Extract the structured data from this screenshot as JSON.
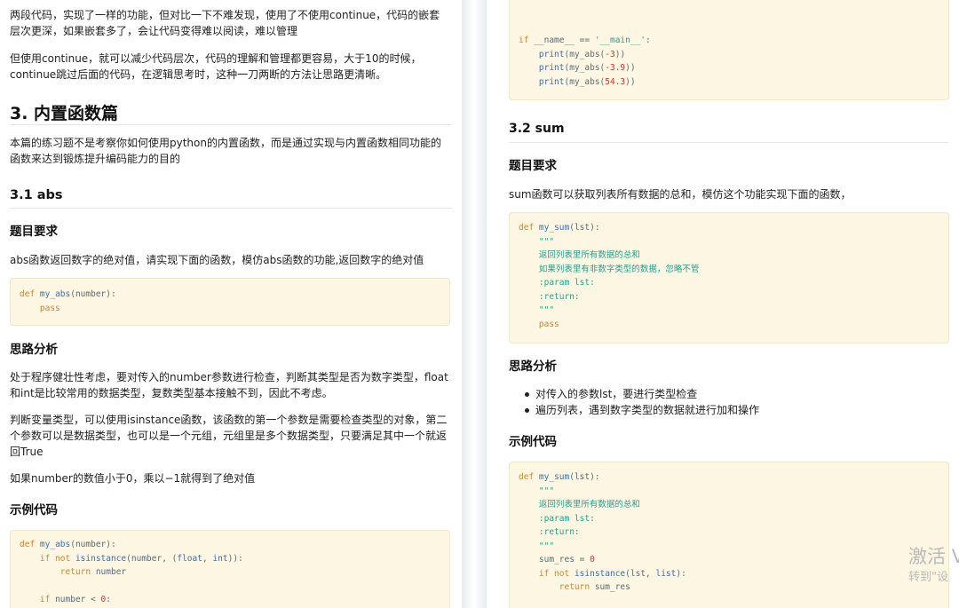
{
  "left": {
    "para1_line1": "两段代码，实现了一样的功能，但对比一下不难发现，使用了不使用continue，代码的嵌套",
    "para1_line2": "层次更深，如果嵌套多了，会让代码变得难以阅读，难以管理",
    "para2_line1": "但使用continue，就可以减少代码层次，代码的理解和管理都更容易，大于10的时候，",
    "para2_line2": "continue跳过后面的代码，在逻辑思考时，这种一刀两断的方法让思路更清晰。",
    "section_title": "3. 内置函数篇",
    "intro_line1": "本篇的练习题不是考察你如何使用python的内置函数，而是通过实现与内置函数相同功能的",
    "intro_line2": "函数来达到锻炼提升编码能力的目的",
    "abs_heading": "3.1 abs",
    "req_heading": "题目要求",
    "req_text": "abs函数返回数字的绝对值，请实现下面的函数，模仿abs函数的功能,返回数字的绝对值",
    "code1": [
      "def my_abs(number):",
      "    pass"
    ],
    "analysis_heading": "思路分析",
    "analysis1_line1": "处于程序健壮性考虑，要对传入的number参数进行检查，判断其类型是否为数字类型，float",
    "analysis1_line2": "和int是比较常用的数据类型，复数类型基本接触不到，因此不考虑。",
    "analysis2_line1": "判断变量类型，可以使用isinstance函数，该函数的第一个参数是需要检查类型的对象，第二",
    "analysis2_line2": "个参数可以是数据类型，也可以是一个元组，元组里是多个数据类型，只要满足其中一个就返",
    "analysis2_line3": "回True",
    "analysis3": "如果number的数值小于0，乘以−1就得到了绝对值",
    "example_heading": "示例代码",
    "code2": [
      "def my_abs(number):",
      "    if not isinstance(number, (float, int)):",
      "        return number",
      "",
      "    if number < 0:"
    ]
  },
  "right": {
    "code_top": [
      "if __name__ == '__main__':",
      "    print(my_abs(-3))",
      "    print(my_abs(-3.9))",
      "    print(my_abs(54.3))"
    ],
    "sum_heading": "3.2 sum",
    "req_heading": "题目要求",
    "req_text": "sum函数可以获取列表所有数据的总和，模仿这个功能实现下面的函数，",
    "code3": [
      "def my_sum(lst):",
      "    \"\"\"",
      "    返回列表里所有数据的总和",
      "    如果列表里有非数字类型的数据，忽略不管",
      "    :param lst:",
      "    :return:",
      "    \"\"\"",
      "    pass"
    ],
    "analysis_heading": "思路分析",
    "bullets": [
      "对传入的参数lst，要进行类型检查",
      "遍历列表，遇到数字类型的数据就进行加和操作"
    ],
    "example_heading": "示例代码",
    "code4": [
      "def my_sum(lst):",
      "    \"\"\"",
      "    返回列表里所有数据的总和",
      "    :param lst:",
      "    :return:",
      "    \"\"\"",
      "    sum_res = 0",
      "    if not isinstance(lst, list):",
      "        return sum_res"
    ]
  },
  "watermark": {
    "line1": "激活 V",
    "line2": "转到\"设"
  }
}
